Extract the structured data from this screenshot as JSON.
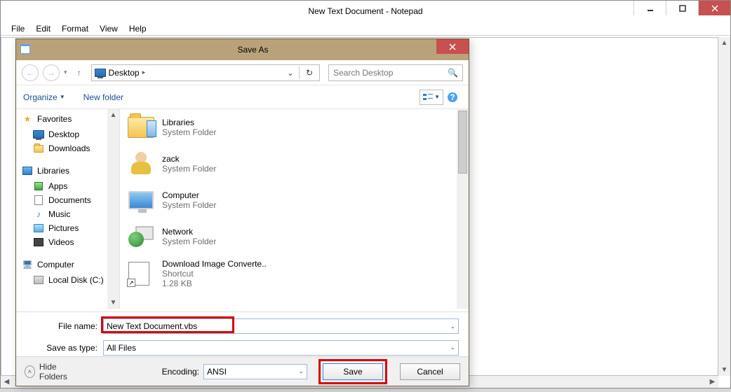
{
  "notepad": {
    "title": "New Text Document - Notepad",
    "menus": [
      "File",
      "Edit",
      "Format",
      "View",
      "Help"
    ]
  },
  "dialog": {
    "title": "Save As",
    "breadcrumb": "Desktop",
    "search_placeholder": "Search Desktop",
    "toolbar": {
      "organize": "Organize",
      "newfolder": "New folder"
    },
    "tree": {
      "favorites": {
        "label": "Favorites",
        "items": [
          "Desktop",
          "Downloads"
        ]
      },
      "libraries": {
        "label": "Libraries",
        "items": [
          "Apps",
          "Documents",
          "Music",
          "Pictures",
          "Videos"
        ]
      },
      "computer": {
        "label": "Computer",
        "items": [
          "Local Disk (C:)"
        ]
      }
    },
    "files": [
      {
        "name": "Libraries",
        "type": "System Folder",
        "size": ""
      },
      {
        "name": "zack",
        "type": "System Folder",
        "size": ""
      },
      {
        "name": "Computer",
        "type": "System Folder",
        "size": ""
      },
      {
        "name": "Network",
        "type": "System Folder",
        "size": ""
      },
      {
        "name": "Download Image Converte..",
        "type": "Shortcut",
        "size": "1.28 KB"
      }
    ],
    "filename_label": "File name:",
    "filename_value": "New Text Document.vbs",
    "saveastype_label": "Save as type:",
    "saveastype_value": "All Files",
    "hide_folders": "Hide Folders",
    "encoding_label": "Encoding:",
    "encoding_value": "ANSI",
    "save_label": "Save",
    "cancel_label": "Cancel"
  }
}
